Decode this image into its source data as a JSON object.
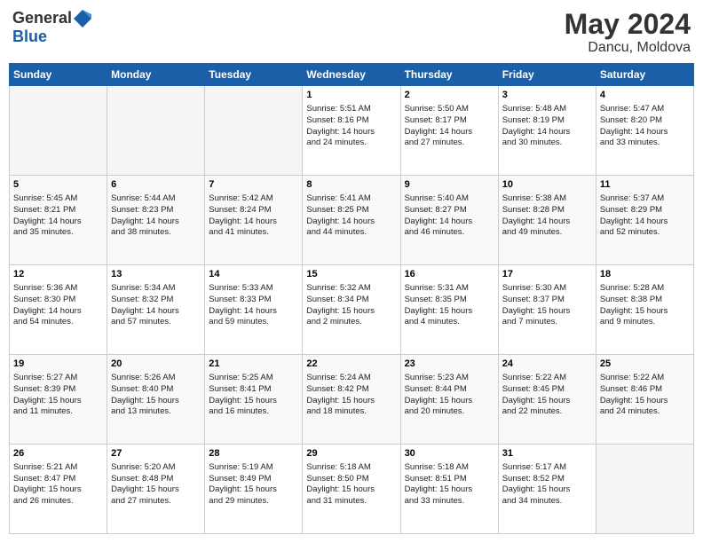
{
  "header": {
    "logo_general": "General",
    "logo_blue": "Blue",
    "month": "May 2024",
    "location": "Dancu, Moldova"
  },
  "days_of_week": [
    "Sunday",
    "Monday",
    "Tuesday",
    "Wednesday",
    "Thursday",
    "Friday",
    "Saturday"
  ],
  "weeks": [
    [
      {
        "day": "",
        "info": ""
      },
      {
        "day": "",
        "info": ""
      },
      {
        "day": "",
        "info": ""
      },
      {
        "day": "1",
        "info": "Sunrise: 5:51 AM\nSunset: 8:16 PM\nDaylight: 14 hours\nand 24 minutes."
      },
      {
        "day": "2",
        "info": "Sunrise: 5:50 AM\nSunset: 8:17 PM\nDaylight: 14 hours\nand 27 minutes."
      },
      {
        "day": "3",
        "info": "Sunrise: 5:48 AM\nSunset: 8:19 PM\nDaylight: 14 hours\nand 30 minutes."
      },
      {
        "day": "4",
        "info": "Sunrise: 5:47 AM\nSunset: 8:20 PM\nDaylight: 14 hours\nand 33 minutes."
      }
    ],
    [
      {
        "day": "5",
        "info": "Sunrise: 5:45 AM\nSunset: 8:21 PM\nDaylight: 14 hours\nand 35 minutes."
      },
      {
        "day": "6",
        "info": "Sunrise: 5:44 AM\nSunset: 8:23 PM\nDaylight: 14 hours\nand 38 minutes."
      },
      {
        "day": "7",
        "info": "Sunrise: 5:42 AM\nSunset: 8:24 PM\nDaylight: 14 hours\nand 41 minutes."
      },
      {
        "day": "8",
        "info": "Sunrise: 5:41 AM\nSunset: 8:25 PM\nDaylight: 14 hours\nand 44 minutes."
      },
      {
        "day": "9",
        "info": "Sunrise: 5:40 AM\nSunset: 8:27 PM\nDaylight: 14 hours\nand 46 minutes."
      },
      {
        "day": "10",
        "info": "Sunrise: 5:38 AM\nSunset: 8:28 PM\nDaylight: 14 hours\nand 49 minutes."
      },
      {
        "day": "11",
        "info": "Sunrise: 5:37 AM\nSunset: 8:29 PM\nDaylight: 14 hours\nand 52 minutes."
      }
    ],
    [
      {
        "day": "12",
        "info": "Sunrise: 5:36 AM\nSunset: 8:30 PM\nDaylight: 14 hours\nand 54 minutes."
      },
      {
        "day": "13",
        "info": "Sunrise: 5:34 AM\nSunset: 8:32 PM\nDaylight: 14 hours\nand 57 minutes."
      },
      {
        "day": "14",
        "info": "Sunrise: 5:33 AM\nSunset: 8:33 PM\nDaylight: 14 hours\nand 59 minutes."
      },
      {
        "day": "15",
        "info": "Sunrise: 5:32 AM\nSunset: 8:34 PM\nDaylight: 15 hours\nand 2 minutes."
      },
      {
        "day": "16",
        "info": "Sunrise: 5:31 AM\nSunset: 8:35 PM\nDaylight: 15 hours\nand 4 minutes."
      },
      {
        "day": "17",
        "info": "Sunrise: 5:30 AM\nSunset: 8:37 PM\nDaylight: 15 hours\nand 7 minutes."
      },
      {
        "day": "18",
        "info": "Sunrise: 5:28 AM\nSunset: 8:38 PM\nDaylight: 15 hours\nand 9 minutes."
      }
    ],
    [
      {
        "day": "19",
        "info": "Sunrise: 5:27 AM\nSunset: 8:39 PM\nDaylight: 15 hours\nand 11 minutes."
      },
      {
        "day": "20",
        "info": "Sunrise: 5:26 AM\nSunset: 8:40 PM\nDaylight: 15 hours\nand 13 minutes."
      },
      {
        "day": "21",
        "info": "Sunrise: 5:25 AM\nSunset: 8:41 PM\nDaylight: 15 hours\nand 16 minutes."
      },
      {
        "day": "22",
        "info": "Sunrise: 5:24 AM\nSunset: 8:42 PM\nDaylight: 15 hours\nand 18 minutes."
      },
      {
        "day": "23",
        "info": "Sunrise: 5:23 AM\nSunset: 8:44 PM\nDaylight: 15 hours\nand 20 minutes."
      },
      {
        "day": "24",
        "info": "Sunrise: 5:22 AM\nSunset: 8:45 PM\nDaylight: 15 hours\nand 22 minutes."
      },
      {
        "day": "25",
        "info": "Sunrise: 5:22 AM\nSunset: 8:46 PM\nDaylight: 15 hours\nand 24 minutes."
      }
    ],
    [
      {
        "day": "26",
        "info": "Sunrise: 5:21 AM\nSunset: 8:47 PM\nDaylight: 15 hours\nand 26 minutes."
      },
      {
        "day": "27",
        "info": "Sunrise: 5:20 AM\nSunset: 8:48 PM\nDaylight: 15 hours\nand 27 minutes."
      },
      {
        "day": "28",
        "info": "Sunrise: 5:19 AM\nSunset: 8:49 PM\nDaylight: 15 hours\nand 29 minutes."
      },
      {
        "day": "29",
        "info": "Sunrise: 5:18 AM\nSunset: 8:50 PM\nDaylight: 15 hours\nand 31 minutes."
      },
      {
        "day": "30",
        "info": "Sunrise: 5:18 AM\nSunset: 8:51 PM\nDaylight: 15 hours\nand 33 minutes."
      },
      {
        "day": "31",
        "info": "Sunrise: 5:17 AM\nSunset: 8:52 PM\nDaylight: 15 hours\nand 34 minutes."
      },
      {
        "day": "",
        "info": ""
      }
    ]
  ]
}
